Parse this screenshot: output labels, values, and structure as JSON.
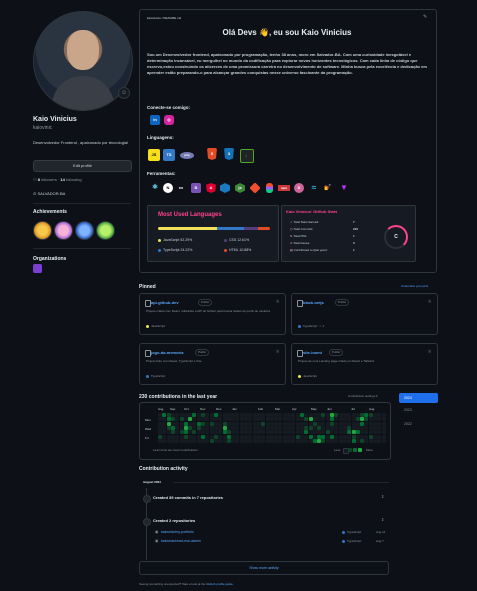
{
  "profile": {
    "name": "Kaio Vinicius",
    "login": "kaiovinic",
    "bio": "Desenvolvedor Frontend , apaixonado por tecnologia!",
    "edit_label": "Edit profile",
    "followers_count": "8",
    "followers_label": "followers",
    "following_count": "14",
    "following_label": "following",
    "location": "SALVADOR-BA",
    "achievements_title": "Achievements",
    "organizations_title": "Organizations"
  },
  "readme": {
    "path": "kaiovinicio / README.md",
    "greeting": "Olá Devs 👋, eu sou Kaio Vinicius",
    "intro": "Sou um Desenvolvedor frontend, apaixonado por programação, tenho 38 anos, moro em Salvador-BA. Com uma curiosidade inesgotável e determinação incansável, eu mergulhei no mundo da codificação para explorar novos horizontes tecnológicos. Com cada linha de código que escrevo,estou construindo os alicerces de uma promissora carreira no desenvolvimento de software. Minha busca pela excelência e dedicação em aprender estão preparando-o para alcançar grandes conquistas nesse universo fascinante da programação.",
    "connect_title": "Conecte-se comigo:",
    "languages_title": "Linguagens:",
    "tools_title": "Ferramentas:",
    "connect_icons": [
      "linkedin-icon",
      "instagram-icon"
    ],
    "language_icons": [
      "JS",
      "TS",
      "php-icon",
      "HTML5",
      "CSS3",
      "bash-icon"
    ],
    "tool_icons": [
      "react-icon",
      "next-icon",
      "ex",
      "B",
      "angular-icon",
      "webpack-icon",
      "node-icon",
      "git-icon",
      "figma-icon",
      "npm-icon",
      "sass-icon",
      "tailwind-icon",
      "styled-icon",
      "vite-icon"
    ]
  },
  "top_langs": {
    "title": "Most Used Languages",
    "langs": [
      {
        "name": "JavaScript",
        "pct": "52.29%",
        "color": "#f1e05a"
      },
      {
        "name": "CSS",
        "pct": "12.61%",
        "color": "#563d7c"
      },
      {
        "name": "TypeScript",
        "pct": "24.22%",
        "color": "#3178c6"
      },
      {
        "name": "HTML",
        "pct": "10.88%",
        "color": "#e34c26"
      }
    ]
  },
  "gh_stats": {
    "title": "Kaio Vinicius' GitHub Stats",
    "rows": [
      {
        "label": "Total Stars Earned:",
        "value": "7"
      },
      {
        "label": "Total Commits:",
        "value": "226"
      },
      {
        "label": "Total PRs:",
        "value": "1"
      },
      {
        "label": "Total Issues:",
        "value": "0"
      },
      {
        "label": "Contributed to (last year):",
        "value": "1"
      }
    ],
    "grade": "C"
  },
  "pinned": {
    "title": "Pinned",
    "customize": "Customize your pins",
    "public_label": "Public",
    "repos": [
      {
        "name": "api-github-dev",
        "desc": "Projeto criado com React, utilizando a API do Github para buscar dados de perfis de usuários",
        "lang": "JavaScript",
        "lang_color": "#f1e05a",
        "stars": ""
      },
      {
        "name": "black-netjs",
        "desc": "",
        "lang": "TypeScript",
        "lang_color": "#3178c6",
        "stars": "1"
      },
      {
        "name": "jogo-da-memoria",
        "desc": "Projeto feito com React, TypeScript e Vite",
        "lang": "TypeScript",
        "lang_color": "#3178c6",
        "stars": ""
      },
      {
        "name": "site-loomi",
        "desc": "Projeto de uma Landing page criado em React e Tailwind",
        "lang": "JavaScript",
        "lang_color": "#f1e05a",
        "stars": ""
      }
    ]
  },
  "contributions": {
    "title": "230 contributions in the last year",
    "settings": "Contribution settings ▾",
    "months": [
      "Aug",
      "Sep",
      "Oct",
      "Nov",
      "Dec",
      "Jan",
      "Feb",
      "Mar",
      "Apr",
      "May",
      "Jun",
      "Jul",
      "Aug"
    ],
    "days": [
      "Mon",
      "Wed",
      "Fri"
    ],
    "learn": "Learn how we count contributions",
    "less": "Less",
    "more": "More",
    "years": [
      "2024",
      "2023",
      "2022"
    ],
    "levels": [
      0,
      0,
      0,
      0,
      0,
      1,
      0,
      2,
      0,
      0,
      0,
      0,
      0,
      0,
      1,
      2,
      3,
      1,
      0,
      0,
      0,
      0,
      1,
      0,
      2,
      1,
      0,
      0,
      0,
      0,
      0,
      0,
      0,
      0,
      0,
      0,
      1,
      0,
      0,
      1,
      0,
      0,
      0,
      0,
      2,
      3,
      2,
      1,
      0,
      0,
      3,
      0,
      1,
      0,
      0,
      0,
      2,
      0,
      0,
      0,
      1,
      0,
      0,
      0,
      0,
      2,
      1,
      0,
      0,
      0,
      1,
      0,
      1,
      0,
      0,
      2,
      0,
      0,
      0,
      0,
      0,
      0,
      0,
      0,
      0,
      0,
      1,
      0,
      0,
      0,
      1,
      2,
      0,
      0,
      0,
      0,
      1,
      0,
      0,
      0,
      0,
      0,
      0,
      0,
      0,
      0,
      0,
      1,
      3,
      2,
      0,
      0,
      0,
      0,
      0,
      0,
      1,
      2,
      1,
      0,
      0,
      0,
      0,
      0,
      0,
      0,
      0,
      0,
      0,
      0,
      0,
      0,
      0,
      0,
      0,
      0,
      0,
      0,
      0,
      0,
      0,
      0,
      0,
      0,
      0,
      0,
      0,
      0,
      0,
      0,
      0,
      0,
      0,
      0,
      0,
      0,
      0,
      0,
      0,
      0,
      0,
      0,
      0,
      0,
      0,
      0,
      0,
      0,
      0,
      0,
      1,
      0,
      0,
      0,
      0,
      0,
      0,
      0,
      0,
      0,
      0,
      0,
      0,
      0,
      0,
      0,
      0,
      0,
      0,
      0,
      0,
      0,
      0,
      0,
      0,
      0,
      0,
      0,
      0,
      0,
      0,
      0,
      0,
      0,
      0,
      0,
      0,
      0,
      0,
      0,
      0,
      0,
      0,
      0,
      0,
      0,
      0,
      0,
      0,
      0,
      0,
      0,
      0,
      0,
      0,
      0,
      0,
      0,
      0,
      1,
      0,
      2,
      0,
      0,
      0,
      0,
      0,
      0,
      0,
      1,
      0,
      1,
      2,
      0,
      0,
      0,
      3,
      0,
      1,
      0,
      2,
      0,
      0,
      0,
      1,
      0,
      0,
      0,
      2,
      0,
      0,
      0,
      1,
      0,
      2,
      3,
      1,
      0,
      0,
      0,
      0,
      2,
      1,
      0,
      0,
      0,
      0,
      1,
      0,
      0,
      3,
      2,
      1,
      0,
      0,
      2,
      0,
      1,
      0,
      0,
      0,
      0,
      0,
      0,
      0,
      0,
      0,
      0,
      0,
      0,
      0,
      0,
      0,
      0,
      0,
      0,
      0,
      0,
      0,
      0,
      0,
      1,
      2,
      0,
      0,
      0,
      0,
      0,
      0,
      3,
      1,
      2,
      0,
      1,
      0,
      0,
      2,
      0,
      0,
      1,
      3,
      2,
      0,
      0,
      0,
      1,
      2,
      1,
      0,
      0,
      0,
      0,
      0,
      1,
      0,
      0,
      0,
      0,
      1,
      0,
      0,
      0,
      0,
      0,
      0,
      0,
      0,
      0,
      0,
      0,
      0,
      0,
      0,
      0,
      0,
      0,
      0,
      0,
      0,
      0,
      0,
      0,
      0,
      0,
      0,
      0,
      0,
      1,
      0,
      2,
      0,
      0,
      0,
      0,
      0,
      0,
      0,
      0
    ]
  },
  "activity": {
    "title": "Contribution activity",
    "month": "August 2024",
    "commits_text": "Created 39 commits in 7 repositories",
    "repos_text": "Created 2 repositories",
    "created": [
      {
        "name": "kaiovinic/my-portfolio",
        "lang": "TypeScript",
        "date": "Aug 11"
      },
      {
        "name": "kaiovinic/react-mui-admin",
        "lang": "TypeScript",
        "date": "Aug 7"
      }
    ],
    "more_label": "Show more activity",
    "footer": "Seeing something unexpected? Take a look at the",
    "footer_link": "GitHub profile guide."
  }
}
